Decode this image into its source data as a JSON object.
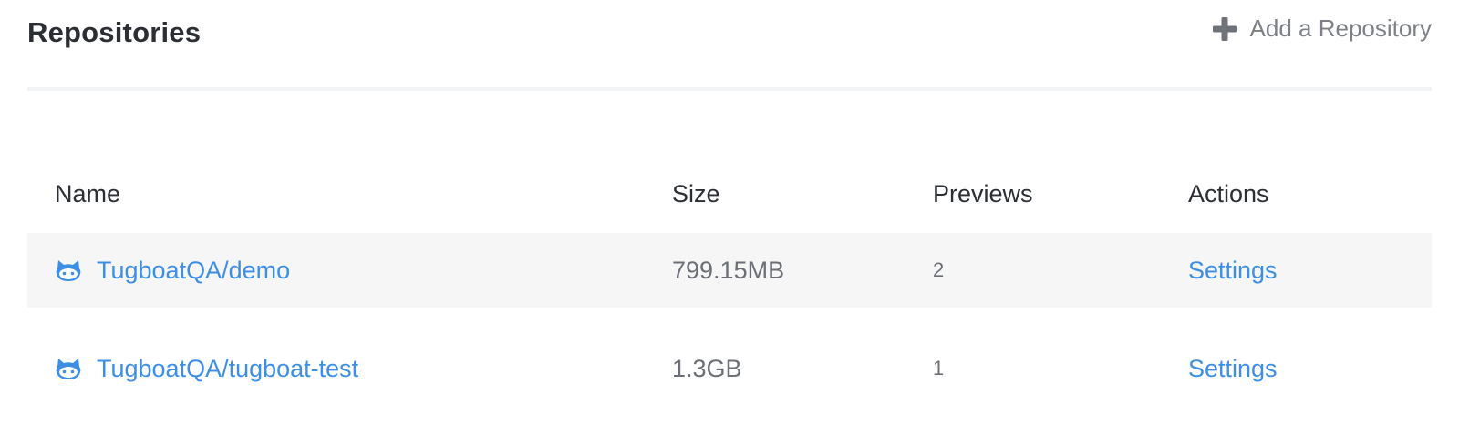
{
  "header": {
    "title": "Repositories",
    "add_label": "Add a Repository",
    "add_icon": "plus-icon"
  },
  "table": {
    "columns": [
      "Name",
      "Size",
      "Previews",
      "Actions"
    ],
    "rows": [
      {
        "name": "TugboatQA/demo",
        "icon": "github-icon",
        "size": "799.15MB",
        "previews": "2",
        "action": "Settings"
      },
      {
        "name": "TugboatQA/tugboat-test",
        "icon": "github-icon",
        "size": "1.3GB",
        "previews": "1",
        "action": "Settings"
      }
    ]
  },
  "colors": {
    "link": "#3d8fe6",
    "text": "#2b2e33",
    "muted": "#6c6f75",
    "row_highlight": "#f6f6f6"
  }
}
